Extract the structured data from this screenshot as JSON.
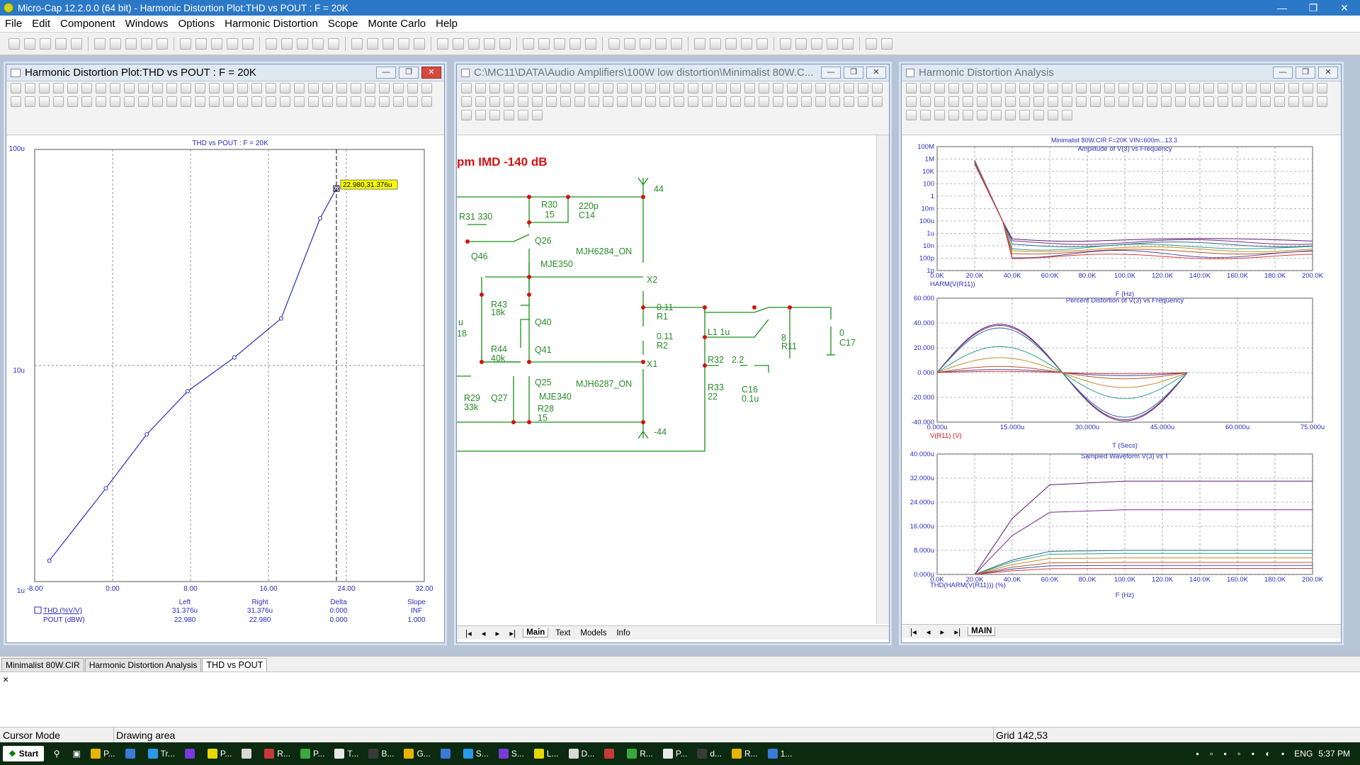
{
  "app": {
    "title": "Micro-Cap 12.2.0.0 (64 bit) - Harmonic Distortion Plot:THD vs POUT : F = 20K",
    "window_controls": [
      "—",
      "❐",
      "✕"
    ]
  },
  "menu": [
    "File",
    "Edit",
    "Component",
    "Windows",
    "Options",
    "Harmonic Distortion",
    "Scope",
    "Monte Carlo",
    "Help"
  ],
  "colors": {
    "accent": "#2b78c6",
    "plot_line": "#2b2bbf",
    "schematic_wire": "#1a8f1a",
    "node": "#d81010",
    "tag_bg": "#ffff00",
    "schematic_text": "#2a8a2a"
  },
  "win_thd": {
    "title": "Harmonic Distortion Plot:THD vs POUT : F = 20K",
    "plot_title": "THD vs POUT : F = 20K",
    "y_ticks": [
      "100u",
      "10u",
      "1u"
    ],
    "x_ticks": [
      "-8.00",
      "0.00",
      "8.00",
      "16.00",
      "24.00",
      "32.00"
    ],
    "cursor_tag": "22.980,31.376u",
    "table": {
      "headers": [
        "Left",
        "Right",
        "Delta",
        "Slope"
      ],
      "rows": [
        {
          "label": "THD (%V/V)",
          "left": "31.376u",
          "right": "31.376u",
          "delta": "0.000",
          "slope": "INF"
        },
        {
          "label": "POUT (dBW)",
          "left": "22.980",
          "right": "22.980",
          "delta": "0.000",
          "slope": "1.000"
        }
      ]
    }
  },
  "chart_data": [
    {
      "type": "line",
      "title": "THD vs POUT : F = 20K",
      "xlabel": "POUT (dBW)",
      "ylabel": "THD (%V/V)",
      "xlim": [
        -8,
        32
      ],
      "ylim": [
        1e-06,
        0.0001
      ],
      "y_scale": "log",
      "grid": true,
      "series": [
        {
          "name": "THD (%V/V)",
          "x": [
            -6.5,
            -0.7,
            3.5,
            7.7,
            12.5,
            17.3,
            21.3,
            22.98
          ],
          "y": [
            1.25e-06,
            2.7e-06,
            4.8e-06,
            7.6e-06,
            1.09e-05,
            1.65e-05,
            4.8e-05,
            6.6e-05
          ]
        }
      ],
      "cursor": {
        "x": 22.98
      }
    },
    {
      "type": "line",
      "title": "Amplitude of V(3) vs Frequency",
      "xlabel": "F (Hz)",
      "ylabel": "HARM(V(R11))",
      "x_ticks": [
        "0.0K",
        "20.0K",
        "40.0K",
        "60.0K",
        "80.0K",
        "100.0K",
        "120.0K",
        "140.0K",
        "160.0K",
        "180.0K",
        "200.0K"
      ],
      "y_ticks": [
        "100M",
        "1M",
        "10K",
        "100",
        "1",
        "10m",
        "100u",
        "1u",
        "10n",
        "100p",
        "1p"
      ],
      "y_scale": "log",
      "xlim": [
        0,
        200000
      ]
    },
    {
      "type": "line",
      "title": "Percent Distortion of V(3) vs Frequency",
      "xlabel": "T (Secs)",
      "ylabel": "V(R11) (V)",
      "x_ticks": [
        "0.000u",
        "15.000u",
        "30.000u",
        "45.000u",
        "60.000u",
        "75.000u"
      ],
      "y_ticks": [
        "60.000",
        "40.000",
        "20.000",
        "0.000",
        "-20.000",
        "-40.000"
      ],
      "xlim": [
        0,
        75
      ],
      "ylim": [
        -40,
        60
      ],
      "series_amplitudes": [
        39,
        38,
        36,
        21,
        12,
        5,
        2.5,
        1
      ]
    },
    {
      "type": "line",
      "title": "Sampled Waveform V(3) vs T",
      "xlabel": "F (Hz)",
      "ylabel": "THD(HARM(V(R11))) (%)",
      "x_ticks": [
        "0.0K",
        "20.0K",
        "40.0K",
        "60.0K",
        "80.0K",
        "100.0K",
        "120.0K",
        "140.0K",
        "160.0K",
        "180.0K",
        "200.0K"
      ],
      "y_ticks": [
        "40.000u",
        "32.000u",
        "24.000u",
        "16.000u",
        "8.000u",
        "0.000u"
      ],
      "xlim": [
        0,
        200000
      ],
      "ylim": [
        0,
        40
      ],
      "plateaus": [
        31,
        21.5,
        8,
        7,
        5.5,
        4,
        3,
        2
      ]
    }
  ],
  "win_schem": {
    "title": "C:\\MC11\\DATA\\Audio Amplifiers\\100W low distortion\\Minimalist 80W.C...",
    "heading": "pm IMD -140 dB",
    "labels": {
      "vplus": "44",
      "vminus": "-44",
      "r30": "R30",
      "r30v": "15",
      "c14v": "220p",
      "c14": "C14",
      "r31": "R31 330",
      "q26": "Q26",
      "q46": "Q46",
      "mje350": "MJE350",
      "mjh6284": "MJH6284_ON",
      "x2": "X2",
      "r43": "R43",
      "r43v": "18k",
      "q40": "Q40",
      "r44": "R44",
      "r44v": "40k",
      "q41": "Q41",
      "u": "u",
      "n18": "18",
      "r1v": "0.11",
      "r1": "R1",
      "r2v": "0.11",
      "r2": "R2",
      "l1": "L1 1u",
      "r11v": "8",
      "r11": "R11",
      "c17v": "0",
      "c17": "C17",
      "r32": "R32",
      "r32v": "2.2",
      "r33": "R33",
      "r33v": "22",
      "c16": "C16",
      "c16v": "0.1u",
      "x1": "X1",
      "mjh6287": "MJH6287_ON",
      "q25": "Q25",
      "q27": "Q27",
      "mje340": "MJE340",
      "r29": "R29",
      "r29v": "33k",
      "r28": "R28",
      "r28v": "15"
    },
    "tabs": [
      "Main",
      "Text",
      "Models",
      "Info"
    ]
  },
  "win_hda": {
    "title": "Harmonic Distortion Analysis",
    "top_caption": "Minimalist 80W.CIR F=20K VIN=600m...13.3",
    "tabs": [
      "MAIN"
    ]
  },
  "doc_tabs": [
    "Minimalist 80W.CIR",
    "Harmonic Distortion Analysis",
    "THD vs POUT"
  ],
  "output_close": "×",
  "status": {
    "mode": "Cursor Mode",
    "area": "Drawing area",
    "grid": "Grid 142,53"
  },
  "taskbar": {
    "start": "Start",
    "items": [
      "P...",
      "",
      "Tr...",
      "",
      "P...",
      "",
      "R...",
      "P...",
      "T...",
      "B...",
      "G...",
      "",
      "S...",
      "S...",
      "L...",
      "D...",
      "",
      "R...",
      "P...",
      "d...",
      "R...",
      "1..."
    ],
    "time": "5:37 PM",
    "lang": "ENG"
  }
}
